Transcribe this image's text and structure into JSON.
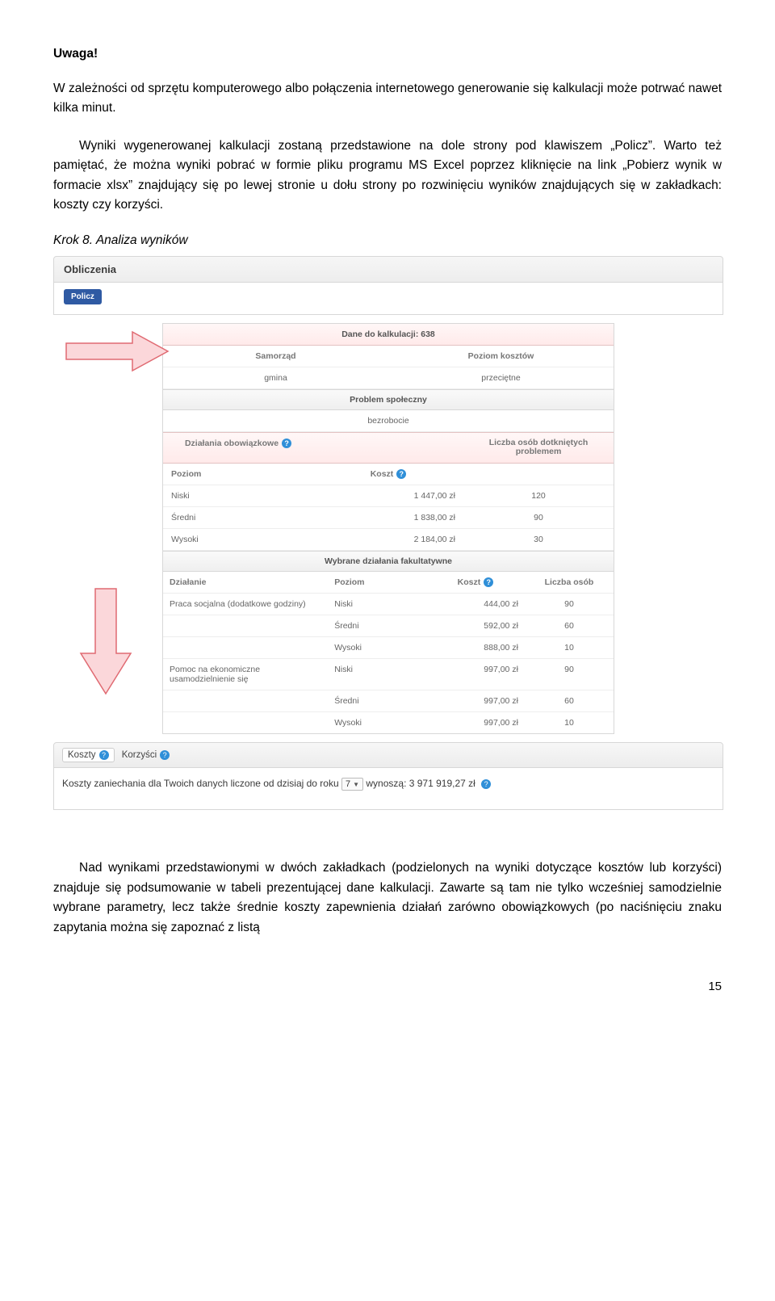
{
  "heading": "Uwaga!",
  "para1": "W zależności od sprzętu komputerowego albo połączenia internetowego generowanie się kalkulacji może potrwać nawet kilka minut.",
  "para2": "Wyniki wygenerowanej kalkulacji zostaną przedstawione na dole strony pod klawiszem „Policz”. Warto też pamiętać, że można wyniki pobrać w formie pliku programu MS Excel poprzez kliknięcie na link „Pobierz wynik w formacie xlsx” znajdujący się po lewej stronie u dołu strony po rozwinięciu wyników znajdujących się w zakładkach: koszty czy korzyści.",
  "step_label": "Krok 8. Analiza wyników",
  "screenshot": {
    "panel_header": "Obliczenia",
    "btn_policz": "Policz",
    "dane_header": "Dane do kalkulacji: 638",
    "samorzad_h": "Samorząd",
    "poziom_kosztow_h": "Poziom kosztów",
    "samorzad_v": "gmina",
    "poziom_kosztow_v": "przeciętne",
    "problem_section": "Problem społeczny",
    "problem_v": "bezrobocie",
    "dz_ob_header": "Działania obowiązkowe",
    "poziom_h": "Poziom",
    "koszt_h": "Koszt",
    "liczba_h": "Liczba osób dotkniętych problemem",
    "rows_ob": [
      {
        "p": "Niski",
        "k": "1 447,00 zł",
        "l": "120"
      },
      {
        "p": "Średni",
        "k": "1 838,00 zł",
        "l": "90"
      },
      {
        "p": "Wysoki",
        "k": "2 184,00 zł",
        "l": "30"
      }
    ],
    "wf_section": "Wybrane działania fakultatywne",
    "wf_dz": "Działanie",
    "wf_p": "Poziom",
    "wf_k": "Koszt",
    "wf_l": "Liczba osób",
    "rows_wf": [
      {
        "d": "Praca socjalna (dodatkowe godziny)",
        "p": "Niski",
        "k": "444,00 zł",
        "l": "90"
      },
      {
        "d": "",
        "p": "Średni",
        "k": "592,00 zł",
        "l": "60"
      },
      {
        "d": "",
        "p": "Wysoki",
        "k": "888,00 zł",
        "l": "10"
      },
      {
        "d": "Pomoc na ekonomiczne usamodzielnienie się",
        "p": "Niski",
        "k": "997,00 zł",
        "l": "90"
      },
      {
        "d": "",
        "p": "Średni",
        "k": "997,00 zł",
        "l": "60"
      },
      {
        "d": "",
        "p": "Wysoki",
        "k": "997,00 zł",
        "l": "10"
      }
    ],
    "tab_koszty": "Koszty",
    "tab_korzysci": "Korzyści",
    "tabs_line_pre": "Koszty zaniechania dla Twoich danych liczone od dzisiaj do roku",
    "tabs_sel": "7",
    "tabs_line_post": "wynoszą: 3 971 919,27 zł"
  },
  "para3": "Nad wynikami przedstawionymi w dwóch zakładkach (podzielonych na wyniki dotyczące kosztów lub korzyści) znajduje się podsumowanie w tabeli prezentującej dane kalkulacji. Zawarte są tam nie tylko wcześniej samodzielnie wybrane parametry, lecz także średnie koszty zapewnienia działań zarówno obowiązkowych (po naciśnięciu znaku zapytania można się zapoznać z listą",
  "page_num": "15"
}
